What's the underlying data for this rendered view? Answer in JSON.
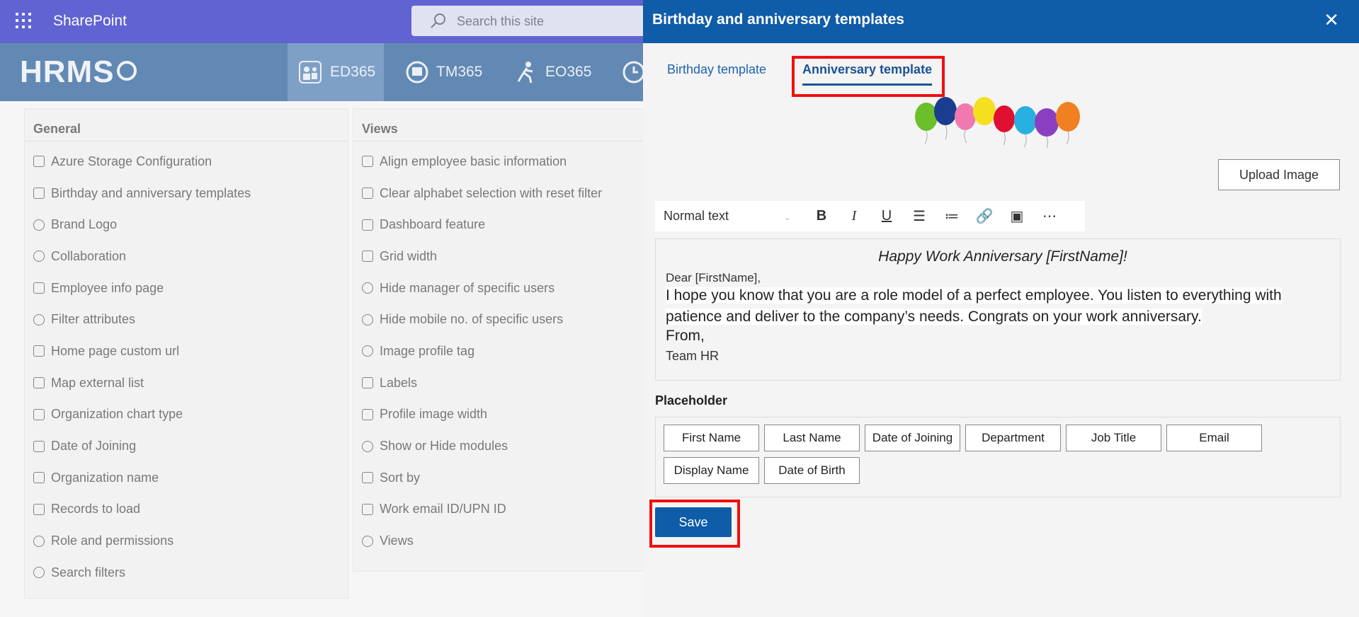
{
  "suite": {
    "app_name": "SharePoint",
    "search_placeholder": "Search this site"
  },
  "hrms": {
    "logo": "HRMS",
    "nav": [
      {
        "label": "ED365"
      },
      {
        "label": "TM365"
      },
      {
        "label": "EO365"
      }
    ]
  },
  "general": {
    "title": "General",
    "items": [
      "Azure Storage Configuration",
      "Birthday and anniversary templates",
      "Brand Logo",
      "Collaboration",
      "Employee info page",
      "Filter attributes",
      "Home page custom url",
      "Map external list",
      "Organization chart type",
      "Date of Joining",
      "Organization name",
      "Records to load",
      "Role and permissions",
      "Search filters"
    ]
  },
  "views": {
    "title": "Views",
    "items": [
      "Align employee basic information",
      "Clear alphabet selection with reset filter",
      "Dashboard feature",
      "Grid width",
      "Hide manager of specific users",
      "Hide mobile no. of specific users",
      "Image profile tag",
      "Labels",
      "Profile image width",
      "Show or Hide modules",
      "Sort by",
      "Work email ID/UPN ID",
      "Views"
    ]
  },
  "panel": {
    "title": "Birthday and anniversary templates",
    "tabs": {
      "birthday": "Birthday template",
      "anniversary": "Anniversary template"
    },
    "upload_label": "Upload Image",
    "toolbar": {
      "format": "Normal text"
    },
    "template": {
      "heading": "Happy Work Anniversary [FirstName]!",
      "greeting": "Dear [FirstName],",
      "line1": "I hope you know that you are a role model of a perfect employee. You listen to everything with",
      "line2": "patience and deliver to the company’s needs. Congrats on your work anniversary.",
      "from": "From,",
      "team": "Team HR"
    },
    "placeholder_label": "Placeholder",
    "placeholders": [
      "First Name",
      "Last Name",
      "Date of Joining",
      "Department",
      "Job Title",
      "Email",
      "Display Name",
      "Date of Birth"
    ],
    "save_label": "Save"
  }
}
